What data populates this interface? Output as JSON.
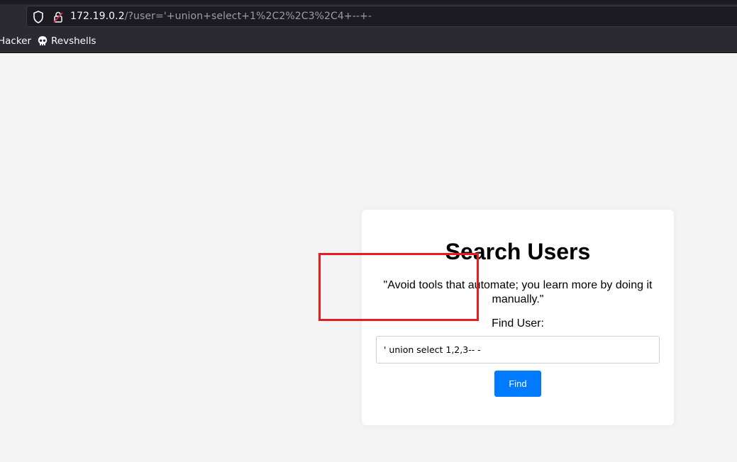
{
  "browser": {
    "url_host": "172.19.0.2",
    "url_path": "/?user='+union+select+1%2C2%2C3%2C4+--+-",
    "bookmarks": [
      {
        "label": "Hacker"
      },
      {
        "label": "Revshells",
        "icon": "skull-icon"
      }
    ]
  },
  "search": {
    "title": "Search Users",
    "quote": "\"Avoid tools that automate; you learn more by doing it manually.\"",
    "find_label": "Find User:",
    "input_value": "' union select 1,2,3-- -",
    "button_label": "Find"
  },
  "colors": {
    "button": "#007bff",
    "highlight": "#e81c1c",
    "chrome": "#2b2a33",
    "page_bg": "#f4f4f4"
  }
}
